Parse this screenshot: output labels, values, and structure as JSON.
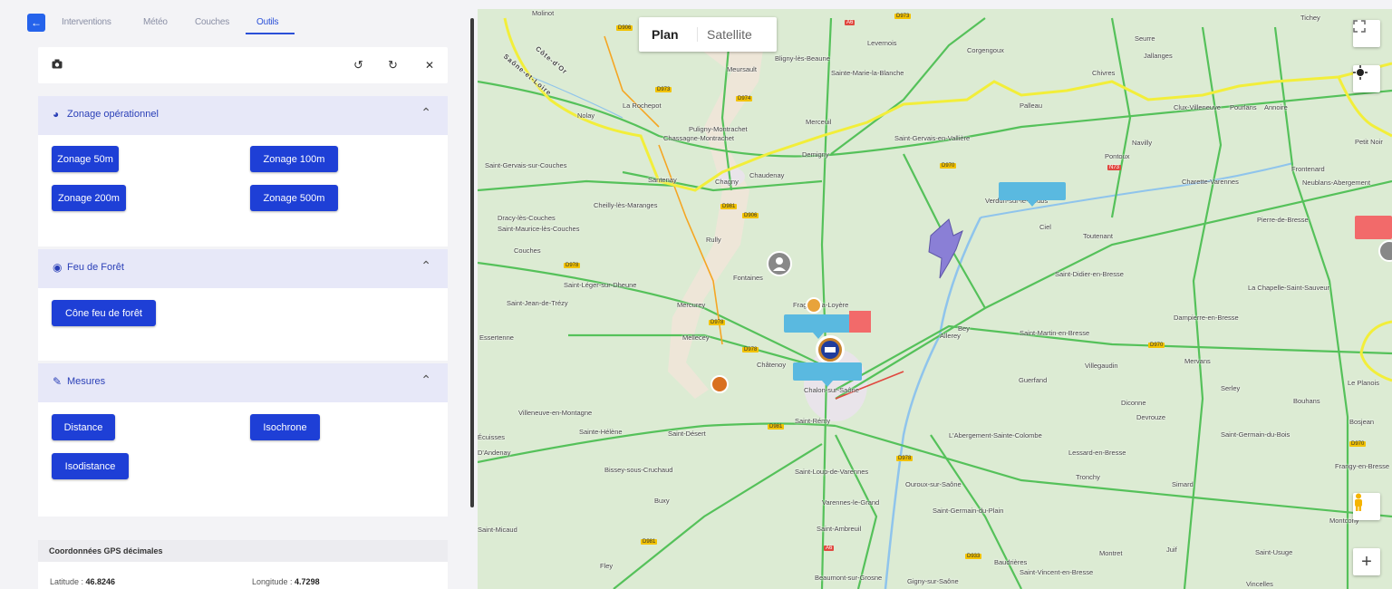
{
  "nav": {
    "tabs": [
      {
        "label": "Interventions"
      },
      {
        "label": "Météo"
      },
      {
        "label": "Couches"
      },
      {
        "label": "Outils"
      }
    ],
    "active_tab": "Outils"
  },
  "toolbar": {
    "icons": [
      "camera-icon",
      "undo-icon",
      "redo-icon",
      "close-icon"
    ]
  },
  "sections": {
    "zonage": {
      "title": "Zonage opérationnel",
      "buttons": [
        "Zonage 50m",
        "Zonage 100m",
        "Zonage 200m",
        "Zonage 500m"
      ]
    },
    "feu": {
      "title": "Feu de Forêt",
      "buttons": [
        "Cône feu de forêt"
      ]
    },
    "mesures": {
      "title": "Mesures",
      "buttons": [
        "Distance",
        "Isochrone",
        "Isodistance"
      ]
    }
  },
  "gps": {
    "title": "Coordonnées GPS décimales",
    "latitude_label": "Latitude : ",
    "latitude_value": "46.8246",
    "longitude_label": "Longitude : ",
    "longitude_value": "4.7298"
  },
  "map": {
    "type_buttons": {
      "plan": "Plan",
      "satellite": "Satellite"
    },
    "places": [
      "Molinot",
      "Meursault",
      "Bligny-lès-Beaune",
      "Levernois",
      "Corgengoux",
      "Seurre",
      "Jallanges",
      "Tichey",
      "La Rochepot",
      "Nolay",
      "Puligny-Montrachet",
      "Chassagne-Montrachet",
      "Merceuil",
      "Sainte-Marie-la-Blanche",
      "Palleau",
      "Chivres",
      "Clux-Villeneuve",
      "Pourlans",
      "Annoire",
      "Saint-Gervais-en-Vallière",
      "Navilly",
      "Saint-Gervais-sur-Couches",
      "Santenay",
      "Chagny",
      "Chaudenay",
      "Demigny",
      "Pontoux",
      "Charette-Varennes",
      "Frontenard",
      "Neublans-Abergement",
      "Petit Noir",
      "Verdun-sur-le-Doubs",
      "Ciel",
      "Toutenant",
      "Cheilly-lès-Maranges",
      "Dracy-lès-Couches",
      "Saint-Maurice-lès-Couches",
      "Couches",
      "Rully",
      "Fontaines",
      "Pierre-de-Bresse",
      "Saint-Didier-en-Bresse",
      "Saint-Léger-sur-Dheune",
      "Saint-Jean-de-Trézy",
      "Mercurey",
      "Fragnes-la-Loyère",
      "Allerey",
      "Bey",
      "La Chapelle-Saint-Sauveur",
      "Essertenne",
      "Mellecey",
      "Châtenoy",
      "Saint-Martin-en-Bresse",
      "Dampierre-en-Bresse",
      "Villegaudin",
      "Mervans",
      "Chalon-sur-Saône",
      "Guerfand",
      "Serley",
      "Le Planois",
      "Villeneuve-en-Montagne",
      "Diconne",
      "Devrouze",
      "Bouhans",
      "Sainte-Hélène",
      "Saint-Désert",
      "Saint-Rémy",
      "L'Abergement-Sainte-Colombe",
      "Saint-Germain-du-Bois",
      "Bosjean",
      "Écuisses",
      "Lessard-en-Bresse",
      "Frangy-en-Bresse",
      "Bissey-sous-Cruchaud",
      "Saint-Loup-de-Varennes",
      "Ouroux-sur-Saône",
      "Tronchy",
      "Simard",
      "Buxy",
      "Varennes-le-Grand",
      "Saint-Germain-du-Plain",
      "Montcony",
      "Saint-Micaud",
      "Saint-Ambreuil",
      "Fley",
      "Beaumont-sur-Grosne",
      "Gigny-sur-Saône",
      "Baudrières",
      "Saint-Vincent-en-Bresse",
      "Montret",
      "Juif",
      "Saint-Usuge",
      "Vincelles",
      "Côte-d'Or",
      "Saône-et-Loire",
      "D'Andenay"
    ]
  }
}
